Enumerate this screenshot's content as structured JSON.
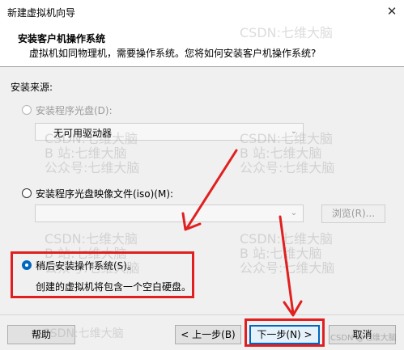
{
  "window": {
    "title": "新建虚拟机向导",
    "close_glyph": "✕"
  },
  "header": {
    "title": "安装客户机操作系统",
    "subtitle": "虚拟机如同物理机，需要操作系统。您将如何安装客户机操作系统?"
  },
  "source": {
    "label": "安装来源:",
    "disc": {
      "label": "安装程序光盘(D):",
      "selected": "无可用驱动器",
      "enabled": false
    },
    "iso": {
      "label": "安装程序光盘映像文件(iso)(M):",
      "value": "",
      "browse": "浏览(R)...",
      "enabled": false
    },
    "later": {
      "label": "稍后安装操作系统(S)。",
      "description": "创建的虚拟机将包含一个空白硬盘。",
      "checked": true
    }
  },
  "footer": {
    "help": "帮助",
    "back": "< 上一步(B)",
    "next": "下一步(N) >",
    "cancel": "取消"
  },
  "watermarks": {
    "line1": "CSDN:七维大脑",
    "line2": "B 站:七维大脑",
    "line3": "公众号:七维大脑",
    "corner": "CSDN @七维大脑"
  },
  "icons": {
    "chevron": "chevron-down-icon",
    "close": "close-icon"
  },
  "colors": {
    "accent": "#0067c0",
    "annotation": "#e02020"
  }
}
